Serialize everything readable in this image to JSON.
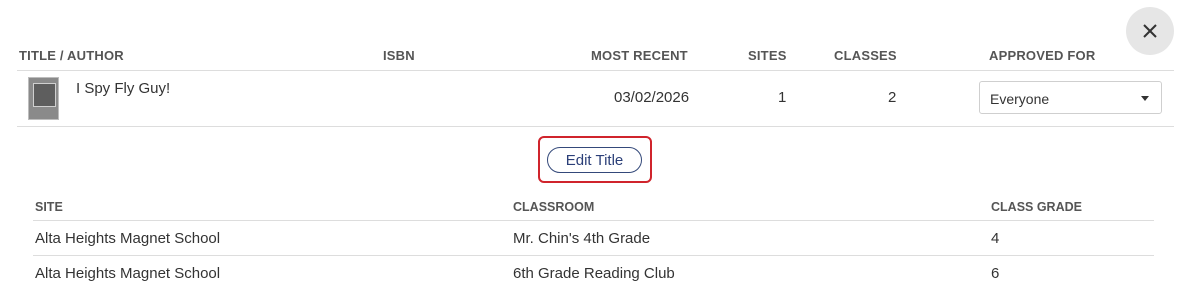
{
  "table": {
    "headers": {
      "title_author": "TITLE / AUTHOR",
      "isbn": "ISBN",
      "most_recent": "MOST RECENT",
      "sites": "SITES",
      "classes": "CLASSES",
      "approved_for": "APPROVED FOR"
    },
    "row": {
      "title": "I Spy Fly Guy!",
      "isbn": "",
      "most_recent": "03/02/2026",
      "sites": "1",
      "classes": "2",
      "approved_for": "Everyone"
    }
  },
  "actions": {
    "edit_title_label": "Edit Title",
    "close_icon": "close-icon"
  },
  "detail": {
    "headers": {
      "site": "SITE",
      "classroom": "CLASSROOM",
      "class_grade": "CLASS GRADE"
    },
    "rows": [
      {
        "site": "Alta Heights Magnet School",
        "classroom": "Mr. Chin's 4th Grade",
        "grade": "4"
      },
      {
        "site": "Alta Heights Magnet School",
        "classroom": "6th Grade Reading Club",
        "grade": "6"
      }
    ]
  },
  "colors": {
    "highlight_border": "#d0242c",
    "edit_button_text": "#2b3f78"
  }
}
